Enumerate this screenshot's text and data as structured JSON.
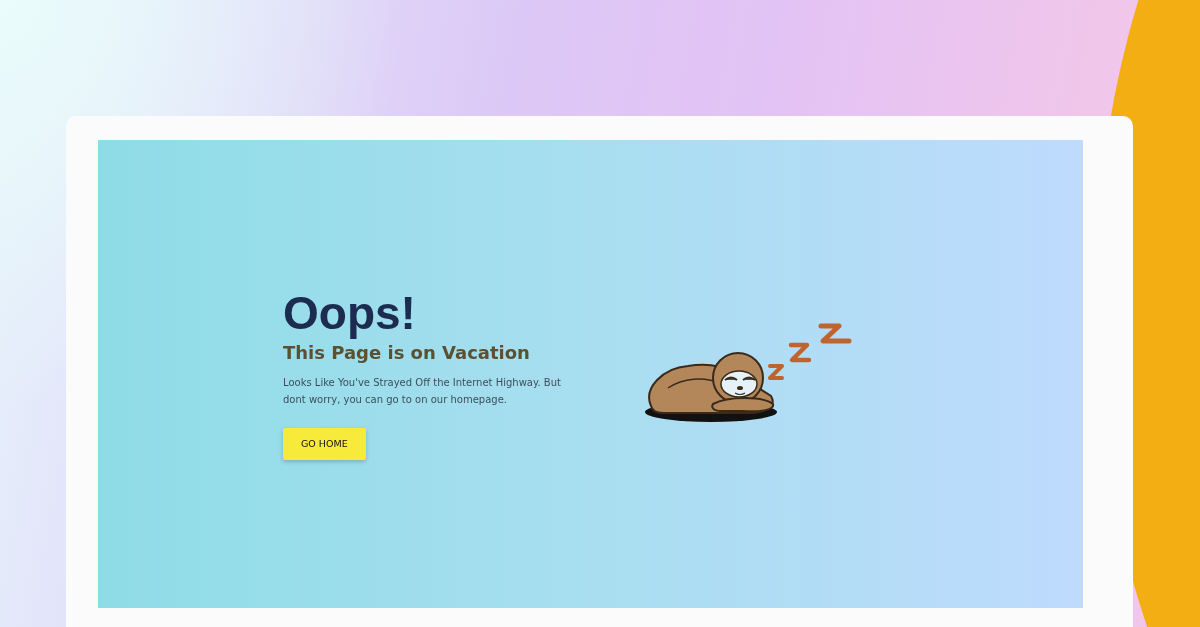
{
  "error_page": {
    "heading": "Oops!",
    "subheading": "This Page is on Vacation",
    "message": "Looks Like You've Strayed Off the Internet Highway. But dont worry, you can go to on our homepage.",
    "button": "GO HOME"
  }
}
